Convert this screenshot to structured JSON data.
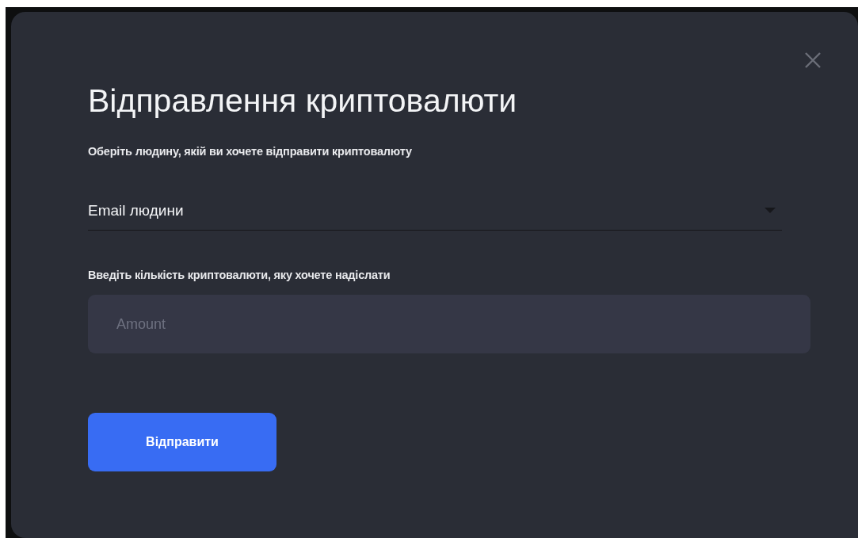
{
  "dialog": {
    "title": "Відправлення криптовалюти",
    "recipient": {
      "label": "Оберіть людину, якій ви хочете відправити криптовалюту",
      "value": "Email людини"
    },
    "amount": {
      "label": "Введіть кількість криптовалюти, яку хочете надіслати",
      "placeholder": "Amount"
    },
    "submit": "Відправити"
  }
}
